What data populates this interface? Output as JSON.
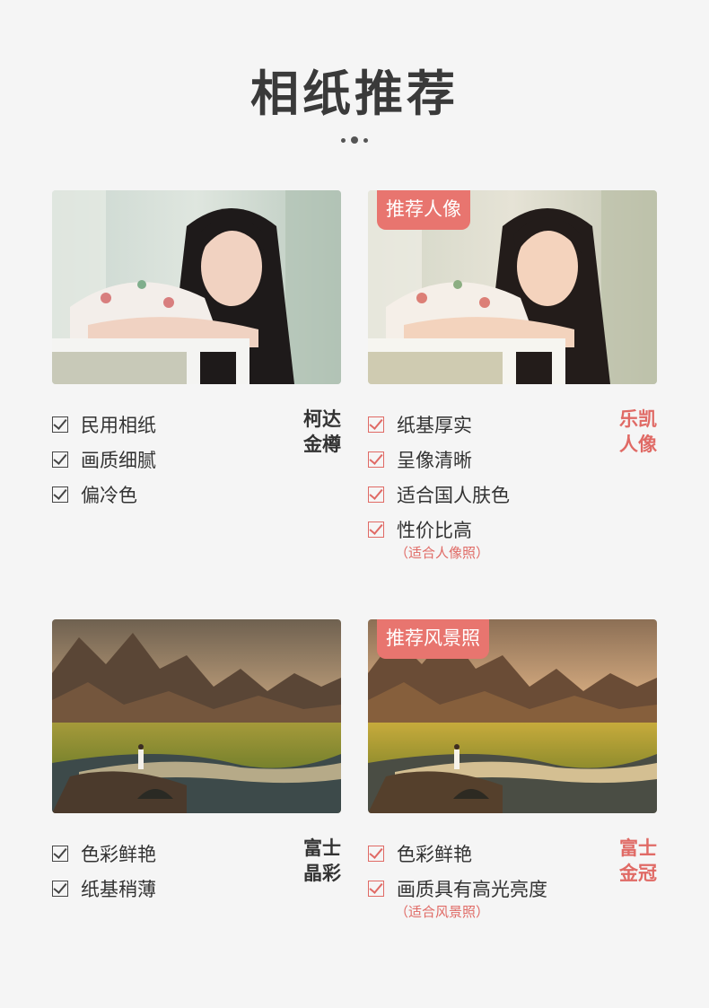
{
  "title": "相纸推荐",
  "cards": [
    {
      "badge": "",
      "features": [
        "民用相纸",
        "画质细腻",
        "偏冷色"
      ],
      "note": "",
      "brand_line1": "柯达",
      "brand_line2": "金樽"
    },
    {
      "badge": "推荐人像",
      "features": [
        "纸基厚实",
        "呈像清晰",
        "适合国人肤色",
        "性价比高"
      ],
      "note": "（适合人像照）",
      "brand_line1": "乐凯",
      "brand_line2": "人像"
    },
    {
      "badge": "",
      "features": [
        "色彩鲜艳",
        "纸基稍薄"
      ],
      "note": "",
      "brand_line1": "富士",
      "brand_line2": "晶彩"
    },
    {
      "badge": "推荐风景照",
      "features": [
        "色彩鲜艳",
        "画质具有高光亮度"
      ],
      "note": "（适合风景照）",
      "brand_line1": "富士",
      "brand_line2": "金冠"
    }
  ],
  "colors": {
    "accent": "#e06a65",
    "badge_bg": "#e8756f",
    "text": "#333333",
    "background": "#f5f5f5"
  }
}
